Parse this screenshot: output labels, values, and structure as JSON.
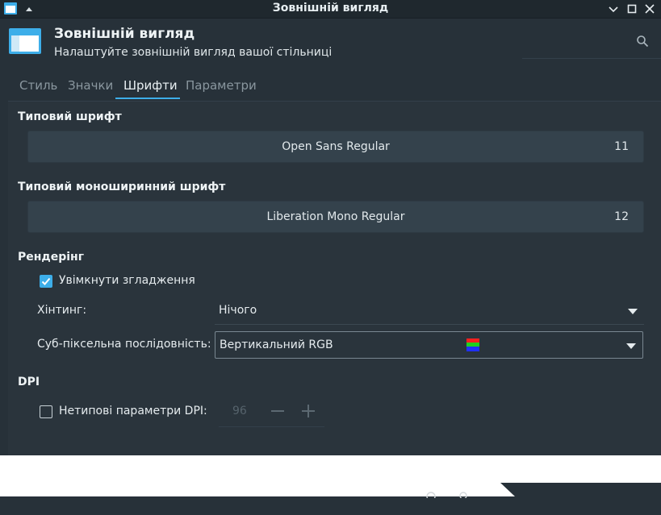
{
  "window": {
    "title": "Зовнішній вигляд"
  },
  "header": {
    "title": "Зовнішній вигляд",
    "subtitle": "Налаштуйте зовнішній вигляд вашої стільниці"
  },
  "tabs": [
    {
      "label": "Стиль",
      "active": false
    },
    {
      "label": "Значки",
      "active": false
    },
    {
      "label": "Шрифти",
      "active": true
    },
    {
      "label": "Параметри",
      "active": false
    }
  ],
  "fonts": {
    "default_heading": "Типовий шрифт",
    "default_font_name": "Open Sans Regular",
    "default_font_size": "11",
    "mono_heading": "Типовий моноширинний шрифт",
    "mono_font_name": "Liberation Mono Regular",
    "mono_font_size": "12"
  },
  "rendering": {
    "heading": "Рендерінг",
    "antialias_label": "Увімкнути згладження",
    "antialias_checked": true,
    "hinting_label": "Хінтинг:",
    "hinting_value": "Нічого",
    "subpixel_label": "Суб-піксельна послідовність:",
    "subpixel_value": "Вертикальний RGB"
  },
  "dpi": {
    "heading": "DPI",
    "custom_label": "Нетипові параметри DPI:",
    "custom_checked": false,
    "value": "96"
  },
  "colors": {
    "accent": "#3daee9",
    "background": "#273139",
    "button": "#34424c"
  }
}
